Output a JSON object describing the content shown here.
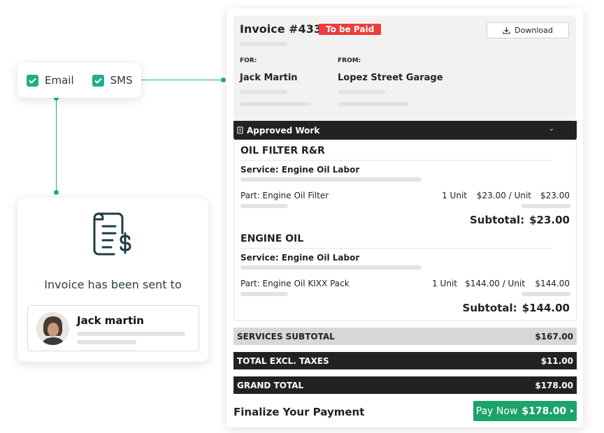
{
  "notify": {
    "email_label": "Email",
    "sms_label": "SMS",
    "email_checked": true,
    "sms_checked": true
  },
  "sent": {
    "message": "Invoice has been sent to",
    "recipient_name": "Jack martin"
  },
  "invoice": {
    "title": "Invoice #43312",
    "status_badge": "To be Paid",
    "download_label": "Download",
    "for_label": "FOR:",
    "from_label": "FROM:",
    "for_name": "Jack Martin",
    "from_name": "Lopez Street Garage"
  },
  "approved_work": {
    "header": "Approved Work",
    "jobs": [
      {
        "title": "OIL FILTER R&R",
        "service": "Service: Engine Oil Labor",
        "part": "Part: Engine Oil Filter",
        "qty": "1 Unit",
        "unit_price": "$23.00 / Unit",
        "amount": "$23.00",
        "subtotal_label": "Subtotal:",
        "subtotal": "$23.00"
      },
      {
        "title": "ENGINE OIL",
        "service": "Service: Engine Oil Labor",
        "part": "Part: Engine Oil KIXX Pack",
        "qty": "1 Unit",
        "unit_price": "$144.00 / Unit",
        "amount": "$144.00",
        "subtotal_label": "Subtotal:",
        "subtotal": "$144.00"
      }
    ]
  },
  "totals": [
    {
      "label": "SERVICES SUBTOTAL",
      "value": "$167.00"
    },
    {
      "label": "TOTAL EXCL. TAXES",
      "value": "$11.00"
    },
    {
      "label": "GRAND TOTAL",
      "value": "$178.00"
    }
  ],
  "finalize_label": "Finalize Your Payment",
  "pay_button": {
    "label": "Pay Now",
    "amount": "$178.00"
  },
  "colors": {
    "accent": "#1fae8e",
    "pay_green": "#1ca36b",
    "badge_red": "#ea3d3d",
    "dark_band": "#222222"
  }
}
